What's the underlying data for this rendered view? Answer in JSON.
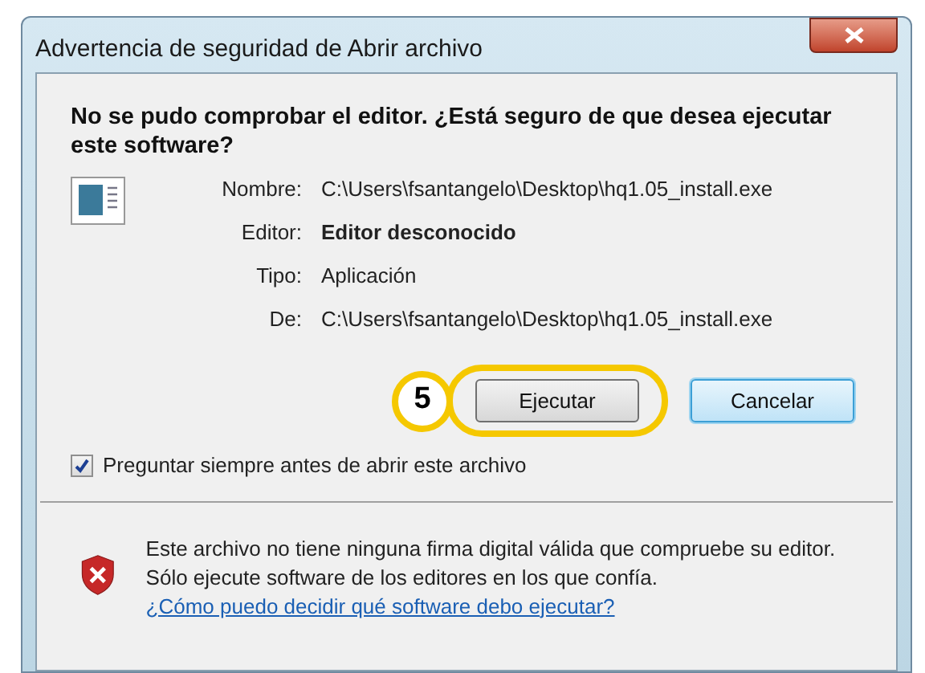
{
  "window": {
    "title": "Advertencia de seguridad de Abrir archivo"
  },
  "heading": "No se pudo comprobar el editor. ¿Está seguro de que desea ejecutar este software?",
  "details": [
    {
      "label": "Nombre:",
      "value": "C:\\Users\\fsantangelo\\Desktop\\hq1.05_install.exe",
      "bold": false
    },
    {
      "label": "Editor:",
      "value": "Editor desconocido",
      "bold": true
    },
    {
      "label": "Tipo:",
      "value": "Aplicación",
      "bold": false
    },
    {
      "label": "De:",
      "value": "C:\\Users\\fsantangelo\\Desktop\\hq1.05_install.exe",
      "bold": false
    }
  ],
  "step_marker": "5",
  "buttons": [
    {
      "label": "Ejecutar",
      "highlighted": true,
      "default": false
    },
    {
      "label": "Cancelar",
      "highlighted": false,
      "default": true
    }
  ],
  "checkbox": {
    "label": "Preguntar siempre antes de abrir este archivo",
    "checked": true
  },
  "warning": {
    "text": "Este archivo no tiene ninguna firma digital válida que compruebe su editor. Sólo ejecute software de los editores en los que confía.",
    "link": "¿Cómo puedo decidir qué software debo ejecutar?"
  }
}
